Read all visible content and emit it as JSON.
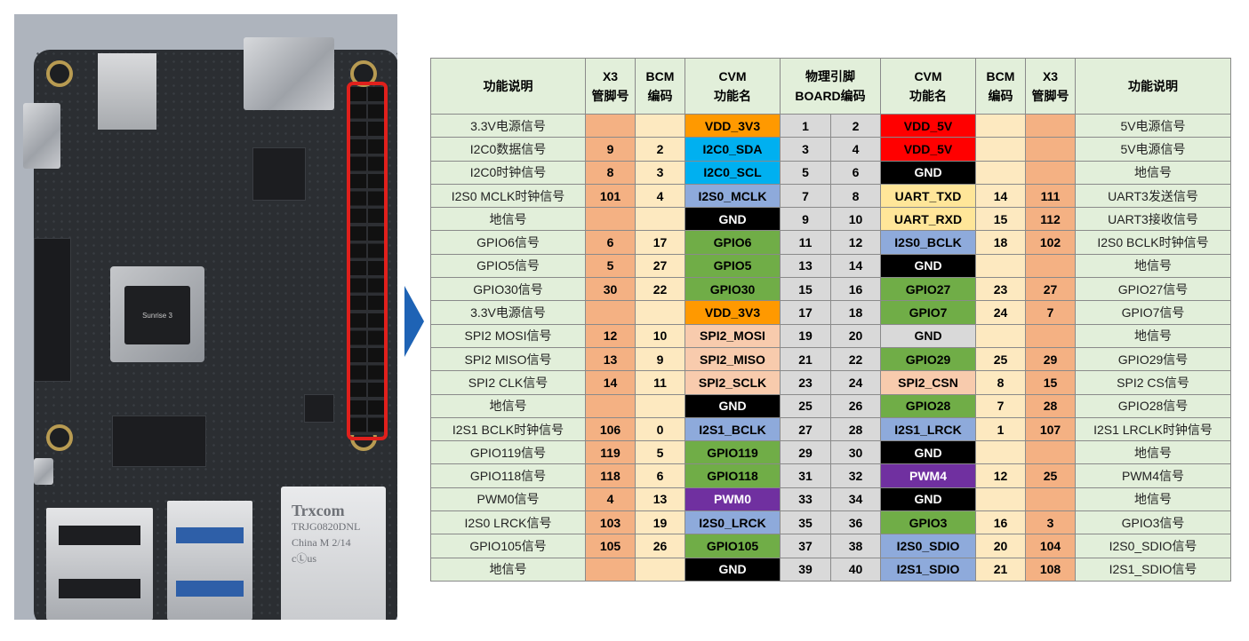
{
  "photo": {
    "rj45_text": [
      "Trxcom",
      "TRJG0820DNL",
      "China M 2/14",
      "cⓁus"
    ],
    "soc_label": "Sunrise 3",
    "highlight_color": "#e0201c",
    "arrow_color": "#1e63b5"
  },
  "table": {
    "headers": {
      "left_desc": "功能说明",
      "left_x3": [
        "X3",
        "管脚号"
      ],
      "left_bcm": [
        "BCM",
        "编码"
      ],
      "left_cvm": [
        "CVM",
        "功能名"
      ],
      "physical": [
        "物理引脚",
        "BOARD编码"
      ],
      "right_cvm": [
        "CVM",
        "功能名"
      ],
      "right_bcm": [
        "BCM",
        "编码"
      ],
      "right_x3": [
        "X3",
        "管脚号"
      ],
      "right_desc": "功能说明"
    },
    "rows": [
      {
        "ld": "3.3V电源信号",
        "lx": "",
        "lb": "",
        "lc": "VDD_3V3",
        "lcc": "VDD3V3",
        "p1": "1",
        "p2": "2",
        "rc": "VDD_5V",
        "rcc": "VDD5V",
        "rb": "",
        "rx": "",
        "rd": "5V电源信号"
      },
      {
        "ld": "I2C0数据信号",
        "lx": "9",
        "lb": "2",
        "lc": "I2C0_SDA",
        "lcc": "I2C",
        "p1": "3",
        "p2": "4",
        "rc": "VDD_5V",
        "rcc": "VDD5V",
        "rb": "",
        "rx": "",
        "rd": "5V电源信号"
      },
      {
        "ld": "I2C0时钟信号",
        "lx": "8",
        "lb": "3",
        "lc": "I2C0_SCL",
        "lcc": "I2C",
        "p1": "5",
        "p2": "6",
        "rc": "GND",
        "rcc": "GND",
        "rb": "",
        "rx": "",
        "rd": "地信号"
      },
      {
        "ld": "I2S0 MCLK时钟信号",
        "lx": "101",
        "lb": "4",
        "lc": "I2S0_MCLK",
        "lcc": "I2S",
        "p1": "7",
        "p2": "8",
        "rc": "UART_TXD",
        "rcc": "UART",
        "rb": "14",
        "rx": "111",
        "rd": "UART3发送信号"
      },
      {
        "ld": "地信号",
        "lx": "",
        "lb": "",
        "lc": "GND",
        "lcc": "GND",
        "p1": "9",
        "p2": "10",
        "rc": "UART_RXD",
        "rcc": "UART",
        "rb": "15",
        "rx": "112",
        "rd": "UART3接收信号"
      },
      {
        "ld": "GPIO6信号",
        "lx": "6",
        "lb": "17",
        "lc": "GPIO6",
        "lcc": "GPIO",
        "p1": "11",
        "p2": "12",
        "rc": "I2S0_BCLK",
        "rcc": "I2S",
        "rb": "18",
        "rx": "102",
        "rd": "I2S0 BCLK时钟信号"
      },
      {
        "ld": "GPIO5信号",
        "lx": "5",
        "lb": "27",
        "lc": "GPIO5",
        "lcc": "GPIO",
        "p1": "13",
        "p2": "14",
        "rc": "GND",
        "rcc": "GND",
        "rb": "",
        "rx": "",
        "rd": "地信号"
      },
      {
        "ld": "GPIO30信号",
        "lx": "30",
        "lb": "22",
        "lc": "GPIO30",
        "lcc": "GPIO",
        "p1": "15",
        "p2": "16",
        "rc": "GPIO27",
        "rcc": "GPIO",
        "rb": "23",
        "rx": "27",
        "rd": "GPIO27信号"
      },
      {
        "ld": "3.3V电源信号",
        "lx": "",
        "lb": "",
        "lc": "VDD_3V3",
        "lcc": "VDD3V3",
        "p1": "17",
        "p2": "18",
        "rc": "GPIO7",
        "rcc": "GPIO",
        "rb": "24",
        "rx": "7",
        "rd": "GPIO7信号"
      },
      {
        "ld": "SPI2 MOSI信号",
        "lx": "12",
        "lb": "10",
        "lc": "SPI2_MOSI",
        "lcc": "SPI",
        "p1": "19",
        "p2": "20",
        "rc": "GND",
        "rcc": "GNDg",
        "rb": "",
        "rx": "",
        "rd": "地信号"
      },
      {
        "ld": "SPI2 MISO信号",
        "lx": "13",
        "lb": "9",
        "lc": "SPI2_MISO",
        "lcc": "SPI",
        "p1": "21",
        "p2": "22",
        "rc": "GPIO29",
        "rcc": "GPIO",
        "rb": "25",
        "rx": "29",
        "rd": "GPIO29信号"
      },
      {
        "ld": "SPI2 CLK信号",
        "lx": "14",
        "lb": "11",
        "lc": "SPI2_SCLK",
        "lcc": "SPI",
        "p1": "23",
        "p2": "24",
        "rc": "SPI2_CSN",
        "rcc": "SPI",
        "rb": "8",
        "rx": "15",
        "rd": "SPI2 CS信号"
      },
      {
        "ld": "地信号",
        "lx": "",
        "lb": "",
        "lc": "GND",
        "lcc": "GND",
        "p1": "25",
        "p2": "26",
        "rc": "GPIO28",
        "rcc": "GPIO",
        "rb": "7",
        "rx": "28",
        "rd": "GPIO28信号"
      },
      {
        "ld": "I2S1 BCLK时钟信号",
        "lx": "106",
        "lb": "0",
        "lc": "I2S1_BCLK",
        "lcc": "I2S",
        "p1": "27",
        "p2": "28",
        "rc": "I2S1_LRCK",
        "rcc": "I2S",
        "rb": "1",
        "rx": "107",
        "rd": "I2S1 LRCLK时钟信号"
      },
      {
        "ld": "GPIO119信号",
        "lx": "119",
        "lb": "5",
        "lc": "GPIO119",
        "lcc": "GPIO",
        "p1": "29",
        "p2": "30",
        "rc": "GND",
        "rcc": "GND",
        "rb": "",
        "rx": "",
        "rd": "地信号"
      },
      {
        "ld": "GPIO118信号",
        "lx": "118",
        "lb": "6",
        "lc": "GPIO118",
        "lcc": "GPIO",
        "p1": "31",
        "p2": "32",
        "rc": "PWM4",
        "rcc": "PWM",
        "rb": "12",
        "rx": "25",
        "rd": "PWM4信号"
      },
      {
        "ld": "PWM0信号",
        "lx": "4",
        "lb": "13",
        "lc": "PWM0",
        "lcc": "PWM",
        "p1": "33",
        "p2": "34",
        "rc": "GND",
        "rcc": "GND",
        "rb": "",
        "rx": "",
        "rd": "地信号"
      },
      {
        "ld": "I2S0 LRCK信号",
        "lx": "103",
        "lb": "19",
        "lc": "I2S0_LRCK",
        "lcc": "I2S",
        "p1": "35",
        "p2": "36",
        "rc": "GPIO3",
        "rcc": "GPIO",
        "rb": "16",
        "rx": "3",
        "rd": "GPIO3信号"
      },
      {
        "ld": "GPIO105信号",
        "lx": "105",
        "lb": "26",
        "lc": "GPIO105",
        "lcc": "GPIO",
        "p1": "37",
        "p2": "38",
        "rc": "I2S0_SDIO",
        "rcc": "I2S",
        "rb": "20",
        "rx": "104",
        "rd": "I2S0_SDIO信号"
      },
      {
        "ld": "地信号",
        "lx": "",
        "lb": "",
        "lc": "GND",
        "lcc": "GND",
        "p1": "39",
        "p2": "40",
        "rc": "I2S1_SDIO",
        "rcc": "I2S",
        "rb": "21",
        "rx": "108",
        "rd": "I2S1_SDIO信号"
      }
    ]
  }
}
